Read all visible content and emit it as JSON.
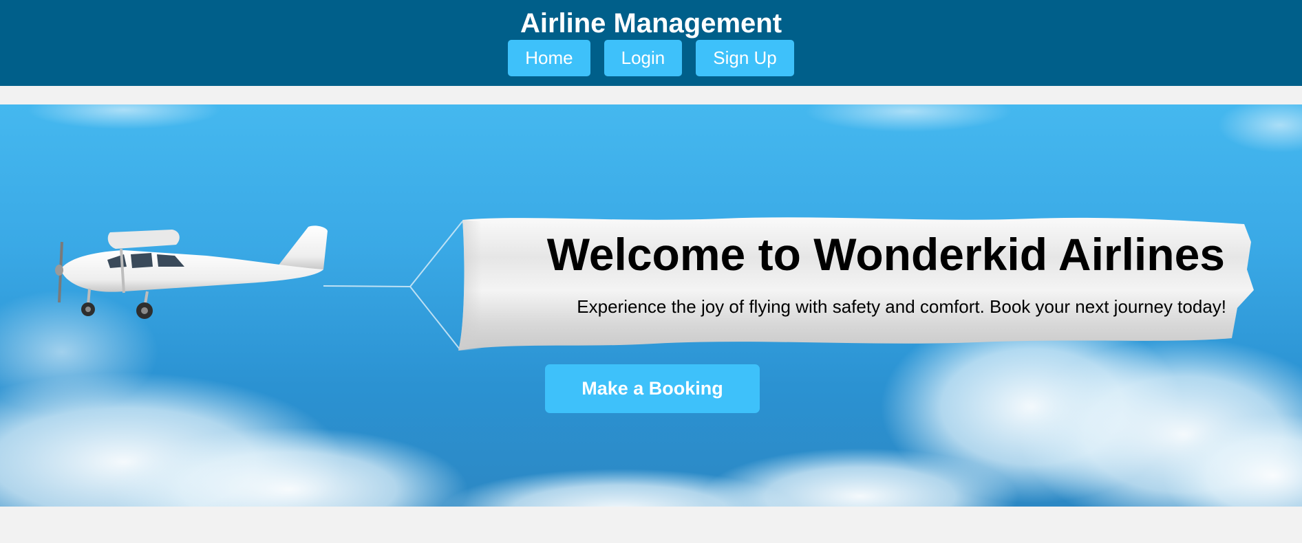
{
  "header": {
    "title": "Airline Management",
    "nav": [
      "Home",
      "Login",
      "Sign Up"
    ],
    "bg_color": "#005f8a",
    "button_color": "#3ec1fa"
  },
  "hero": {
    "title": "Welcome to Wonderkid Airlines",
    "subtitle": "Experience the joy of flying with safety and comfort. Book your next journey today!",
    "cta_label": "Make a Booking",
    "sky_color": "#3aa9e6",
    "illustration": "airplane-towing-banner"
  }
}
